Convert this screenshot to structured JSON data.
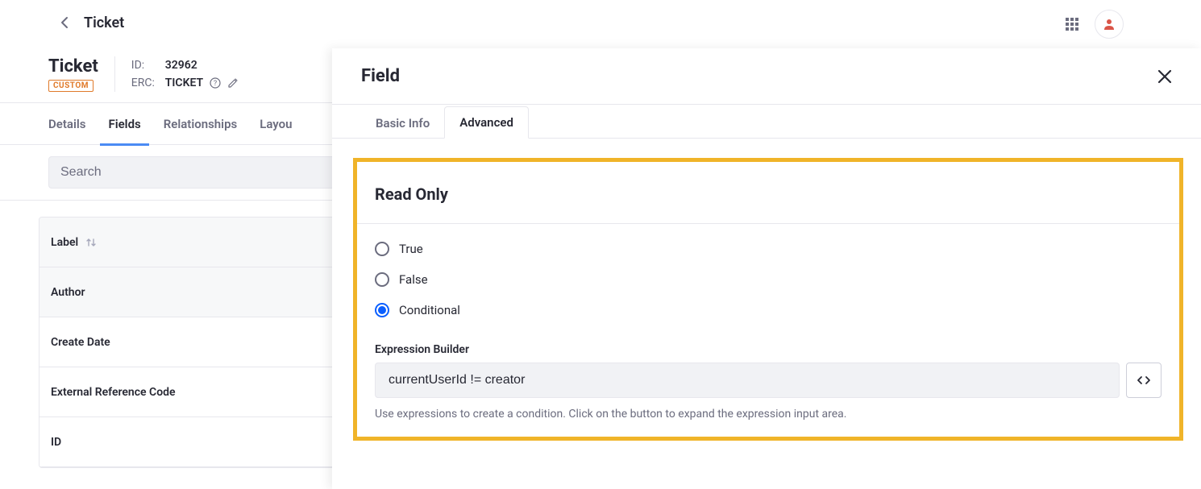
{
  "topbar": {
    "breadcrumb": "Ticket"
  },
  "entity": {
    "name": "Ticket",
    "badge": "CUSTOM",
    "id_label": "ID:",
    "id_value": "32962",
    "erc_label": "ERC:",
    "erc_value": "TICKET"
  },
  "tabs": {
    "details": "Details",
    "fields": "Fields",
    "relationships": "Relationships",
    "layout": "Layou"
  },
  "search": {
    "placeholder": "Search"
  },
  "table": {
    "header": "Label",
    "rows": [
      "Author",
      "Create Date",
      "External Reference Code",
      "ID"
    ]
  },
  "panel": {
    "title": "Field",
    "tabs": {
      "basic": "Basic Info",
      "advanced": "Advanced"
    },
    "section_title": "Read Only",
    "radios": {
      "true": "True",
      "false": "False",
      "conditional": "Conditional"
    },
    "expression": {
      "label": "Expression Builder",
      "value": "currentUserId != creator",
      "help": "Use expressions to create a condition. Click on the button to expand the expression input area."
    }
  }
}
